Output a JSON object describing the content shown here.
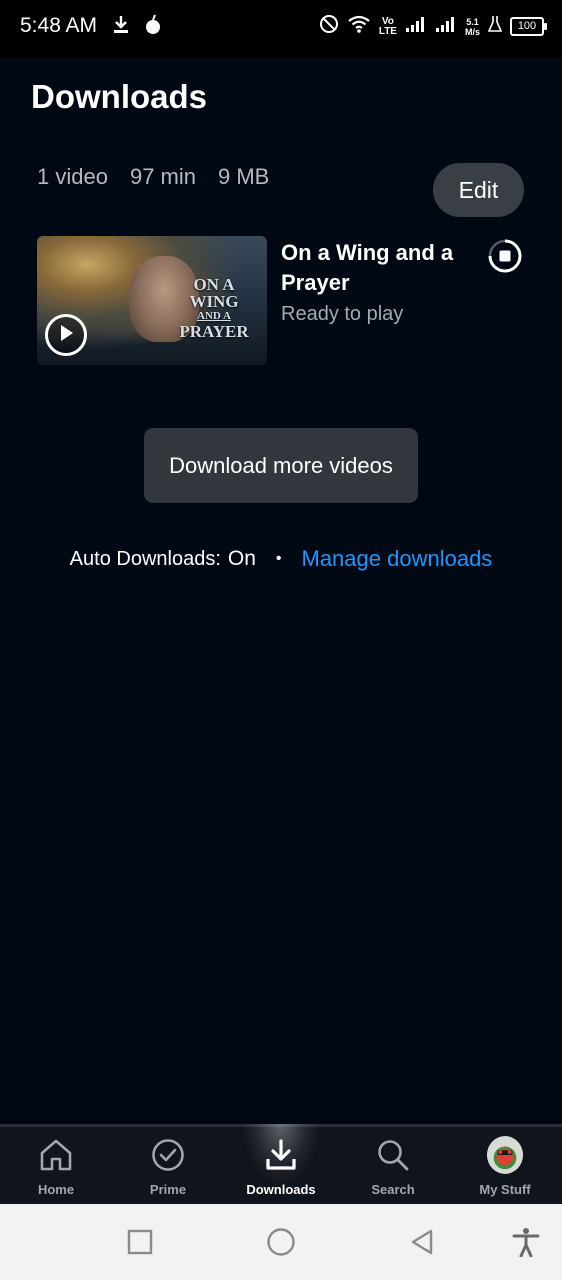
{
  "status_bar": {
    "time": "5:48 AM",
    "left_icons": [
      "download-icon",
      "notification-icon"
    ],
    "right_icons": [
      "do-not-disturb-icon",
      "wifi-icon",
      "volte-icon",
      "signal-1-icon",
      "signal-2-icon",
      "speed-indicator",
      "lab-icon",
      "battery-icon"
    ],
    "volte_top": "Vo",
    "volte_bottom": "LTE",
    "speed_value": "5.1",
    "speed_unit": "M/s",
    "battery": "100"
  },
  "header": {
    "title": "Downloads"
  },
  "summary": {
    "videos": "1 video",
    "duration": "97 min",
    "size": "9 MB",
    "edit_label": "Edit"
  },
  "downloads": [
    {
      "title": "On a Wing and a Prayer",
      "status": "Ready to play",
      "thumbnail": {
        "title_line1": "ON A",
        "title_line2": "WING",
        "title_line3": "AND A",
        "title_line4": "PRAYER"
      }
    }
  ],
  "more_button": {
    "label": "Download more videos"
  },
  "auto_downloads": {
    "label": "Auto Downloads:",
    "value": "On",
    "separator": "•",
    "link": "Manage downloads"
  },
  "bottom_nav": {
    "items": [
      {
        "label": "Home",
        "icon": "home-icon"
      },
      {
        "label": "Prime",
        "icon": "prime-check-icon"
      },
      {
        "label": "Downloads",
        "icon": "download-icon",
        "active": true
      },
      {
        "label": "Search",
        "icon": "search-icon"
      },
      {
        "label": "My Stuff",
        "icon": "avatar-icon"
      }
    ]
  },
  "system_nav": [
    "recent-apps-button",
    "home-button",
    "back-button",
    "accessibility-button"
  ],
  "colors": {
    "background": "#000814",
    "accent_link": "#1a98ff",
    "button_bg": "#32363d",
    "secondary_text": "#a6a9ae"
  }
}
